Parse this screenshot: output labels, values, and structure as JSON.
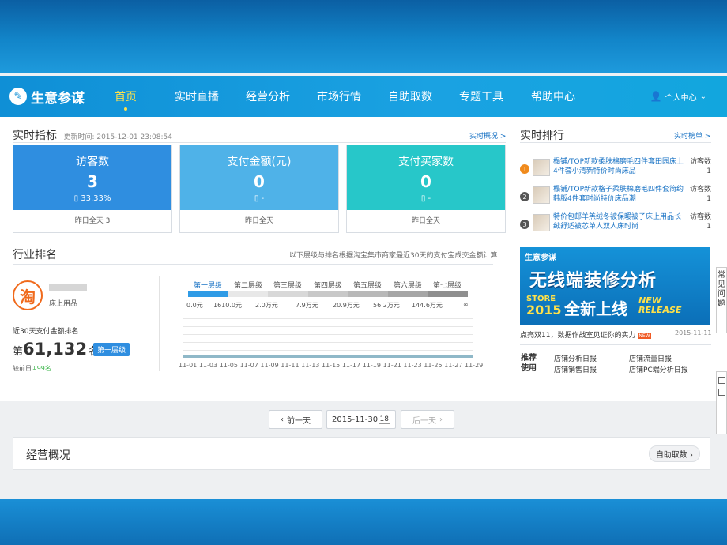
{
  "nav": {
    "logo_text": "生意参谋",
    "items": [
      "首页",
      "实时直播",
      "经营分析",
      "市场行情",
      "自助取数",
      "专题工具",
      "帮助中心"
    ],
    "user_label": "个人中心"
  },
  "realtime": {
    "title": "实时指标",
    "update_prefix": "更新时间: 2015-12-01 23:08:54",
    "overview_link": "实时概况 >",
    "cards": [
      {
        "label": "访客数",
        "value": "3",
        "sub": "33.33%",
        "foot": "昨日全天 3",
        "color": "#2f8ee0"
      },
      {
        "label": "支付金额(元)",
        "value": "0",
        "sub": "-",
        "foot": "昨日全天",
        "color": "#4fb2e8"
      },
      {
        "label": "支付买家数",
        "value": "0",
        "sub": "-",
        "foot": "昨日全天",
        "color": "#27c7c9"
      }
    ]
  },
  "ranking": {
    "title": "实时排行",
    "link": "实时榜单 >",
    "items": [
      {
        "num": "1",
        "text": "榻铺/TOP新款柔肤棉磨毛四件套田园床上4件套小清新特价时尚床品",
        "metric": "访客数",
        "value": "1",
        "color": "#f08a1c"
      },
      {
        "num": "2",
        "text": "榻铺/TOP新款格子柔肤棉磨毛四件套简约韩版4件套时尚特价床品潮",
        "metric": "访客数",
        "value": "1",
        "color": "#555555"
      },
      {
        "num": "3",
        "text": "特价包邮羊羔绒冬被保暖被子床上用品长绒舒适被芯单人双人床时尚",
        "metric": "访客数",
        "value": "1",
        "color": "#555555"
      }
    ]
  },
  "banner": {
    "brand": "生意参谋",
    "line1": "无线端装修分析",
    "store": "STORE",
    "year": "2015",
    "line2": "全新上线",
    "tag": "NEW RELEASE"
  },
  "notice": {
    "text": "点亮双11，数据作战室见证你的实力",
    "badge": "NEW",
    "date": "2015-11-11"
  },
  "recommend": {
    "label1": "推荐",
    "label2": "使用",
    "links": [
      "店铺分析日报",
      "店铺流量日报",
      "店铺销售日报",
      "店铺PC端分析日报"
    ]
  },
  "industry": {
    "title": "行业排名",
    "desc": "以下层级与排名根据淘宝集市商家最近30天的支付宝成交金额计算",
    "shop_icon": "淘",
    "shop_category": "床上用品",
    "rank_label": "近30天支付金额排名",
    "rank_prefix": "第",
    "rank_value": "61,132",
    "rank_suffix": "名",
    "tier_badge": "第一层级",
    "compare_prefix": "较前日",
    "compare_value": "99名",
    "tiers": [
      "第一层级",
      "第二层级",
      "第三层级",
      "第四层级",
      "第五层级",
      "第六层级",
      "第七层级"
    ],
    "tier_values": [
      "0.0元",
      "1610.0元",
      "2.0万元",
      "7.9万元",
      "20.9万元",
      "56.2万元",
      "144.6万元",
      "∞"
    ],
    "xaxis": [
      "11-01",
      "11-03",
      "11-05",
      "11-07",
      "11-09",
      "11-11",
      "11-13",
      "11-15",
      "11-17",
      "11-19",
      "11-21",
      "11-23",
      "11-25",
      "11-27",
      "11-29"
    ]
  },
  "datebar": {
    "prev": "前一天",
    "date": "2015-11-30",
    "next": "后一天"
  },
  "business": {
    "title": "经营概况",
    "button": "自助取数"
  },
  "sidebar": {
    "text": "常见问题"
  }
}
